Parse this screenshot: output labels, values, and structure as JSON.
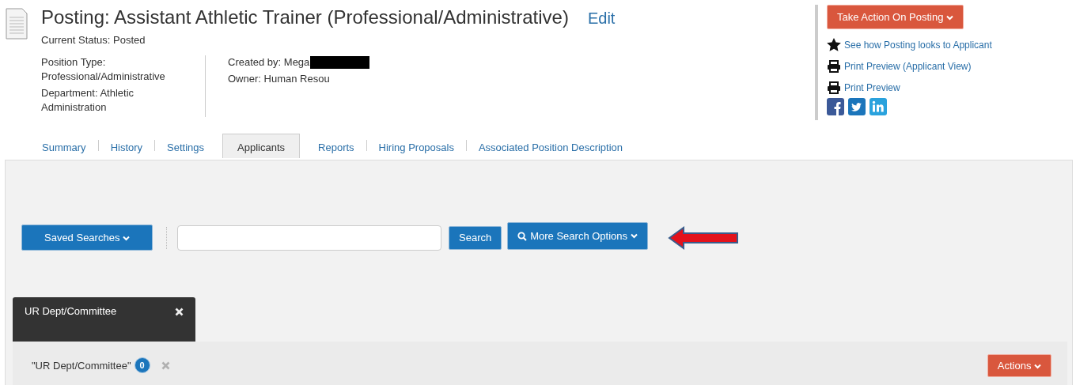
{
  "header": {
    "title": "Posting: Assistant Athletic Trainer (Professional/Administrative)",
    "edit_link": "Edit",
    "status": {
      "label": "Current Status:",
      "value": "Posted"
    },
    "details_left": [
      {
        "label": "Position Type:",
        "value": "Professional/Administrative"
      },
      {
        "label": "Department:",
        "value": "Athletic Administration"
      }
    ],
    "details_right": [
      {
        "label": "Created by:",
        "value": "Mega",
        "redacted": true
      },
      {
        "label": "Owner:",
        "value": "Human Resou",
        "redacted": false
      }
    ]
  },
  "posting_actions": {
    "button": "Take Action On Posting",
    "links": [
      {
        "kind": "star",
        "label": "See how Posting looks to Applicant"
      },
      {
        "kind": "print",
        "label": "Print Preview (Applicant View)"
      },
      {
        "kind": "print",
        "label": "Print Preview"
      }
    ]
  },
  "tabs": [
    {
      "label": "Summary",
      "selected": false
    },
    {
      "label": "History",
      "selected": false
    },
    {
      "label": "Settings",
      "selected": false
    },
    {
      "label": "Applicants",
      "selected": true
    },
    {
      "label": "Reports",
      "selected": false
    },
    {
      "label": "Hiring Proposals",
      "selected": false
    },
    {
      "label": "Associated Position Description",
      "selected": false
    }
  ],
  "search": {
    "saved_searches": "Saved Searches",
    "button": "Search",
    "more_options": "More Search Options"
  },
  "filter": {
    "title": "UR Dept/Committee",
    "chip_label": "\"UR Dept/Committee\"",
    "chip_count": "0"
  },
  "actions_button": "Actions"
}
